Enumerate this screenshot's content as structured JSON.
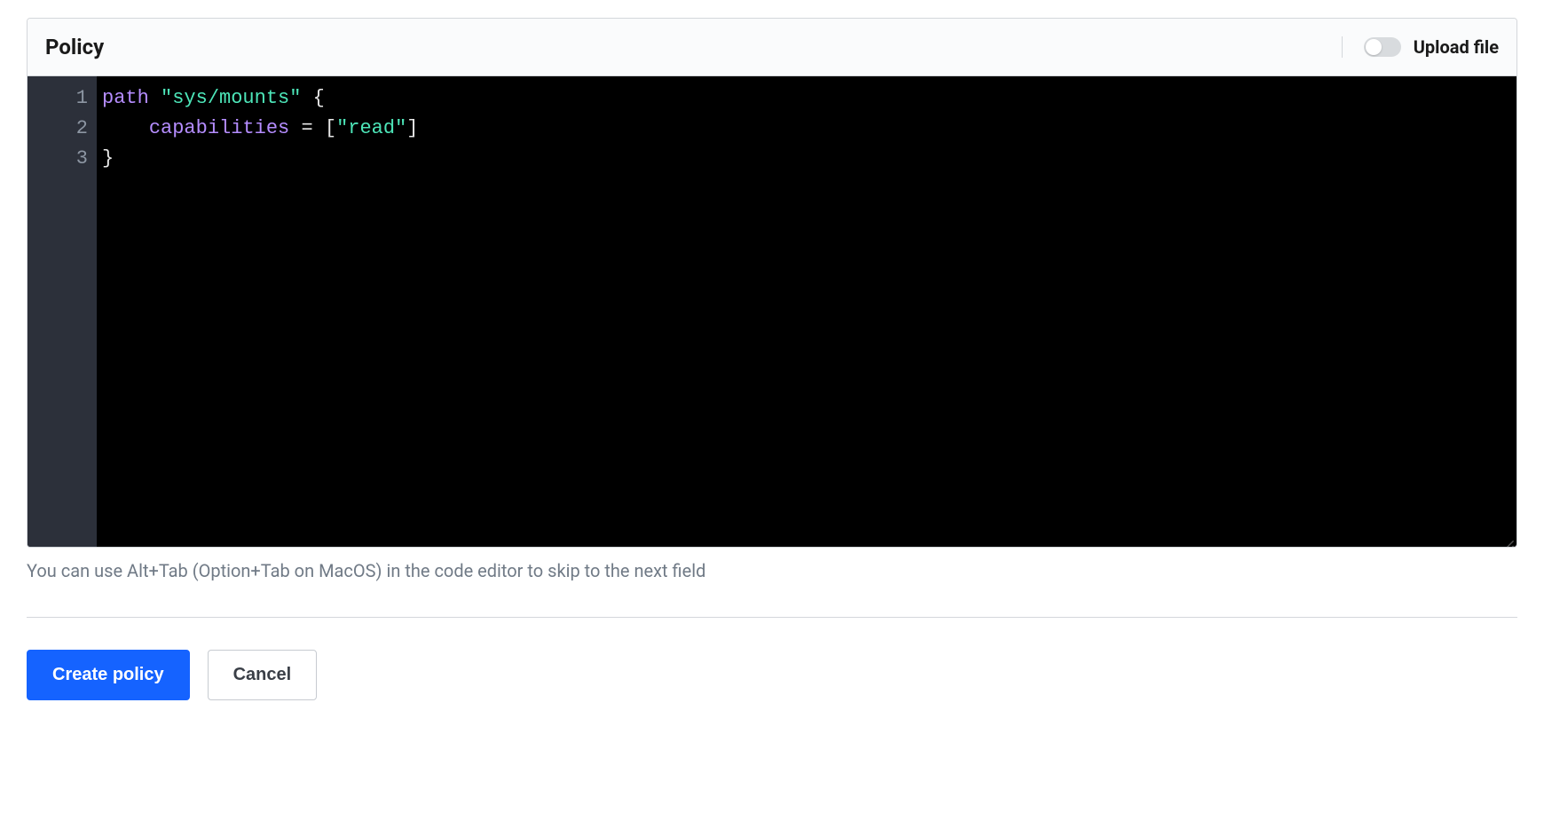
{
  "header": {
    "title": "Policy",
    "upload_label": "Upload file",
    "upload_toggle": false
  },
  "editor": {
    "gutter": [
      "1",
      "2",
      "3"
    ],
    "lines": [
      [
        {
          "cls": "tok-keyword",
          "text": "path"
        },
        {
          "cls": "tok-punct",
          "text": " "
        },
        {
          "cls": "tok-string",
          "text": "\"sys/mounts\""
        },
        {
          "cls": "tok-punct",
          "text": " {"
        }
      ],
      [
        {
          "cls": "tok-punct",
          "text": "    "
        },
        {
          "cls": "tok-ident",
          "text": "capabilities"
        },
        {
          "cls": "tok-punct",
          "text": " = ["
        },
        {
          "cls": "tok-string",
          "text": "\"read\""
        },
        {
          "cls": "tok-punct",
          "text": "]"
        }
      ],
      [
        {
          "cls": "tok-punct",
          "text": "}"
        }
      ]
    ],
    "hint": "You can use Alt+Tab (Option+Tab on MacOS) in the code editor to skip to the next field"
  },
  "actions": {
    "primary": "Create policy",
    "secondary": "Cancel"
  }
}
